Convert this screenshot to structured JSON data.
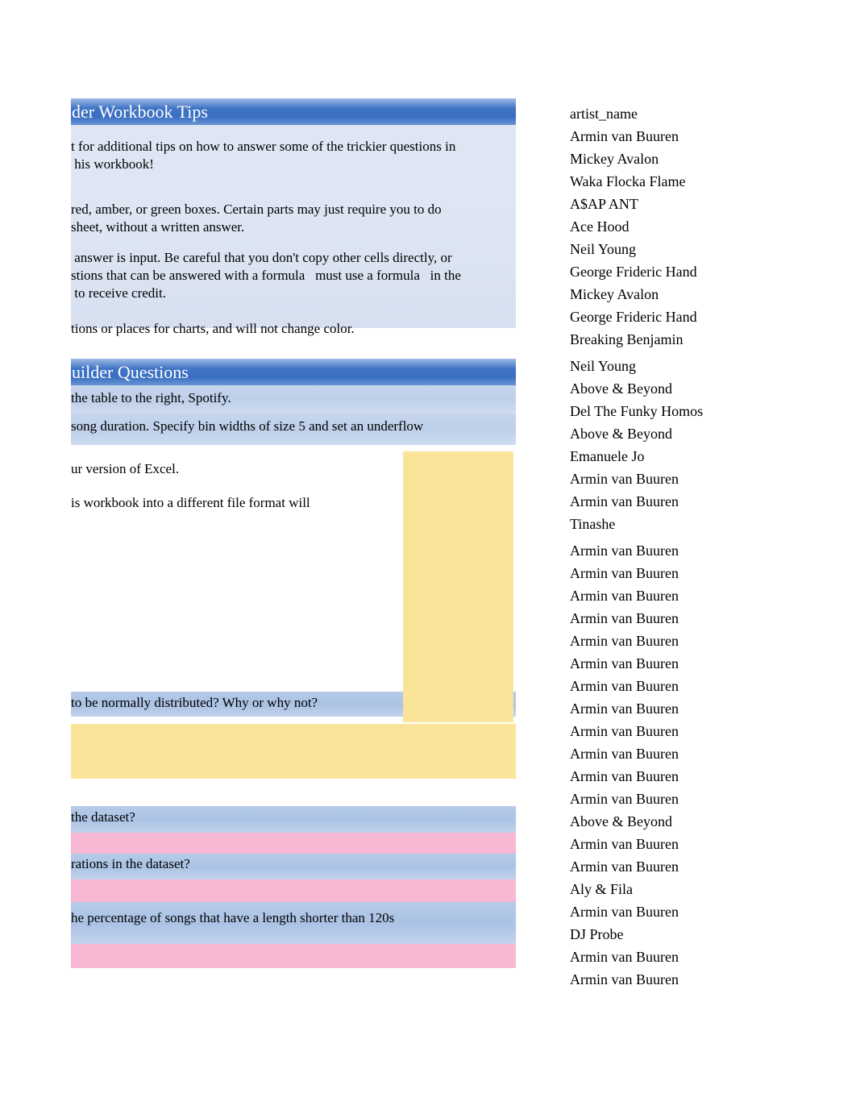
{
  "document": {
    "title": "Workbook Tips and Chart Builder Questions"
  },
  "tips_section": {
    "banner_label": "der Workbook Tips",
    "paragraphs": [
      "t for additional tips on how to answer some of the trickier questions in\n his workbook!",
      "red, amber, or green boxes. Certain parts may just require you to do\nsheet, without a written answer.",
      " answer is input. Be careful that you don't copy other cells directly, or\nstions that can be answered with a formula   must use a formula   in the\n to receive credit.",
      "tions or places for charts, and will not change color."
    ]
  },
  "questions_section": {
    "banner_label": "uilder Questions",
    "rows": [
      {
        "text": "the table to the right,  Spotify.",
        "fill": "blue"
      },
      {
        "text": "song duration. Specify bin widths  of size 5 and set an  underflow",
        "fill": "blue"
      },
      {
        "text": "ur version of Excel.",
        "fill": "white"
      },
      {
        "text": " is workbook into a different file format will",
        "fill": "white"
      },
      {
        "text": "",
        "fill": "white"
      },
      {
        "text": " to be normally distributed? Why or why not?",
        "fill": "bluedark"
      },
      {
        "text": "",
        "fill": "yellow"
      },
      {
        "text": "",
        "fill": "white"
      },
      {
        "text": "the dataset?",
        "fill": "bluedark"
      },
      {
        "text": "",
        "fill": "pink"
      },
      {
        "text": "rations in the dataset?",
        "fill": "bluedark"
      },
      {
        "text": "",
        "fill": "pink"
      },
      {
        "text": " he percentage of songs that have a length   shorter than 120s",
        "fill": "bluedark"
      },
      {
        "text": "",
        "fill": "pink"
      }
    ],
    "answer_box_right": {
      "fill": "yellow"
    }
  },
  "artist_table": {
    "column_header": "artist_name",
    "values": [
      "Armin van Buuren",
      "Mickey Avalon",
      "Waka Flocka Flame",
      "A$AP ANT",
      "Ace Hood",
      "Neil Young",
      "George Frideric Hand",
      "Mickey Avalon",
      "George Frideric Hand",
      "Breaking Benjamin",
      "Neil Young",
      "Above & Beyond",
      "Del The Funky Homos",
      "Above & Beyond",
      "Emanuele Jo",
      "Armin van Buuren",
      "Armin van Buuren",
      "Tinashe",
      "Armin van Buuren",
      "Armin van Buuren",
      "Armin van Buuren",
      "Armin van Buuren",
      "Armin van Buuren",
      "Armin van Buuren",
      "Armin van Buuren",
      "Armin van Buuren",
      "Armin van Buuren",
      "Armin van Buuren",
      "Armin van Buuren",
      "Armin van Buuren",
      "Above & Beyond",
      "Armin van Buuren",
      "Armin van Buuren",
      "Aly & Fila",
      "Armin van Buuren",
      "DJ Probe",
      "Armin van Buuren",
      "Armin van Buuren"
    ]
  },
  "colors": {
    "banner_blue": "#3f73c4",
    "tips_body": "#dfe6f3",
    "band_blue": "#c6d5ec",
    "band_blue_dark": "#aac2e4",
    "band_yellow": "#fae49a",
    "band_pink": "#f6b8d2",
    "text": "#000000"
  }
}
